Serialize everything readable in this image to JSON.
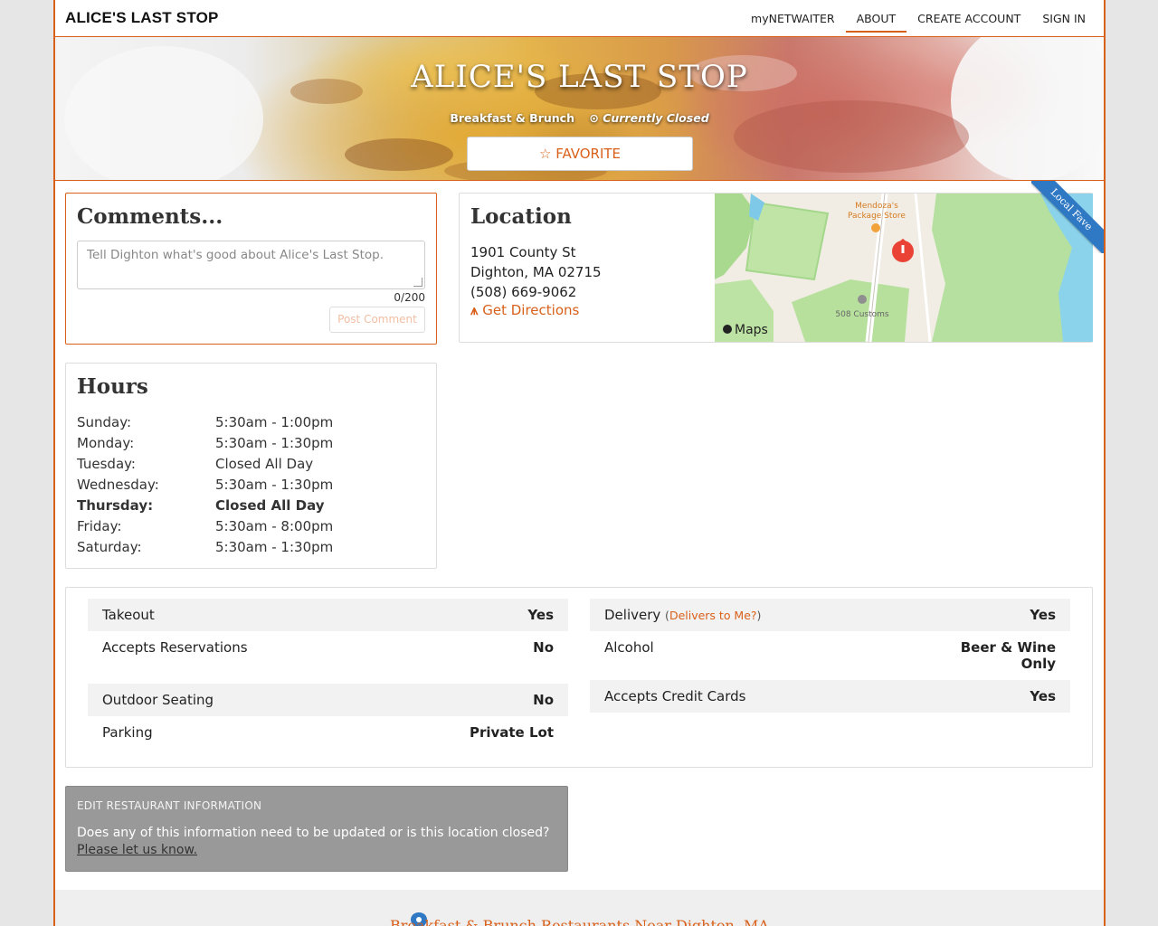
{
  "nav": {
    "brand": "ALICE'S LAST STOP",
    "links": [
      "myNETWAITER",
      "ABOUT",
      "CREATE ACCOUNT",
      "SIGN IN"
    ]
  },
  "hero": {
    "title": "ALICE'S LAST STOP",
    "category": "Breakfast & Brunch",
    "status": "Currently Closed",
    "favorite_label": "FAVORITE"
  },
  "ribbon": "Local Fave",
  "comments": {
    "title": "Comments...",
    "placeholder": "Tell Dighton what's good about Alice's Last Stop.",
    "counter": "0/200",
    "post_label": "Post Comment"
  },
  "location": {
    "title": "Location",
    "street": "1901 County St",
    "city": "Dighton, MA 02715",
    "phone": "(508) 669-9062",
    "directions_label": "Get Directions",
    "map": {
      "poi_1": "Mendoza's",
      "poi_1b": "Package Store",
      "poi_2": "508 Customs",
      "brand": "Maps"
    }
  },
  "hours": {
    "title": "Hours",
    "days": [
      {
        "day": "Sunday:",
        "time": "5:30am - 1:00pm"
      },
      {
        "day": "Monday:",
        "time": "5:30am - 1:30pm"
      },
      {
        "day": "Tuesday:",
        "time": "Closed All Day"
      },
      {
        "day": "Wednesday:",
        "time": "5:30am - 1:30pm"
      },
      {
        "day": "Thursday:",
        "time": "Closed All Day"
      },
      {
        "day": "Friday:",
        "time": "5:30am - 8:00pm"
      },
      {
        "day": "Saturday:",
        "time": "5:30am - 1:30pm"
      }
    ]
  },
  "features": {
    "left": [
      {
        "label": "Takeout",
        "value": "Yes"
      },
      {
        "label": "Accepts Reservations",
        "value": "No"
      },
      {
        "label": "Outdoor Seating",
        "value": "No"
      },
      {
        "label": "Parking",
        "value": "Private Lot"
      }
    ],
    "right": [
      {
        "label": "Delivery",
        "link": "Delivers to Me?",
        "value": "Yes"
      },
      {
        "label": "Alcohol",
        "value_line1": "Beer & Wine",
        "value_line2": "Only"
      },
      {
        "label": "Accepts Credit Cards",
        "value": "Yes"
      }
    ]
  },
  "edit": {
    "title": "EDIT RESTAURANT INFORMATION",
    "text": "Does any of this information need to be updated or is this location closed?",
    "link": "Please let us know."
  },
  "footer": {
    "title": "Breakfast & Brunch Restaurants Near Dighton, MA"
  },
  "colors": {
    "accent": "#d9601a",
    "ribbon": "#2f78c4"
  }
}
